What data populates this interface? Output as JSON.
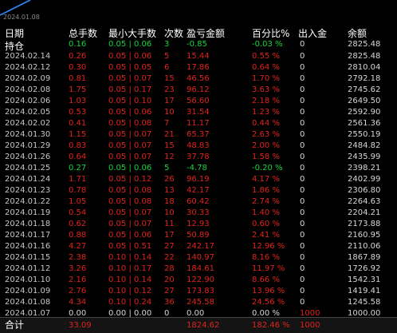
{
  "chart": {
    "date_label": "2024.01.08",
    "line_color": "#2a8cff"
  },
  "headers": {
    "date": "日期",
    "total_lots": "总手数",
    "min_max_lots": "最小大手数",
    "count": "次数",
    "profit": "盈亏金额",
    "percent": "百分比%",
    "deposit_withdraw": "出入金",
    "balance": "余额"
  },
  "holding": {
    "label": "持仓",
    "total_lots": "0.16",
    "min_max_lots": "0.05 | 0.06",
    "count": "3",
    "profit": "-0.85",
    "percent": "-0.03 %",
    "deposit_withdraw": "0",
    "balance": "2825.48"
  },
  "rows": [
    {
      "date": "2024.02.14",
      "lots": "0.26",
      "minmax": "0.05 | 0.06",
      "count": "5",
      "profit": "15.44",
      "pct": "0.55 %",
      "dw": "0",
      "bal": "2825.48",
      "color": "red"
    },
    {
      "date": "2024.02.12",
      "lots": "0.30",
      "minmax": "0.05 | 0.05",
      "count": "6",
      "profit": "17.86",
      "pct": "0.64 %",
      "dw": "0",
      "bal": "2810.04",
      "color": "red"
    },
    {
      "date": "2024.02.09",
      "lots": "0.81",
      "minmax": "0.05 | 0.07",
      "count": "15",
      "profit": "46.56",
      "pct": "1.70 %",
      "dw": "0",
      "bal": "2792.18",
      "color": "red"
    },
    {
      "date": "2024.02.08",
      "lots": "1.75",
      "minmax": "0.05 | 0.17",
      "count": "23",
      "profit": "96.12",
      "pct": "3.63 %",
      "dw": "0",
      "bal": "2745.62",
      "color": "red"
    },
    {
      "date": "2024.02.06",
      "lots": "1.03",
      "minmax": "0.05 | 0.10",
      "count": "17",
      "profit": "56.60",
      "pct": "2.18 %",
      "dw": "0",
      "bal": "2649.50",
      "color": "red"
    },
    {
      "date": "2024.02.05",
      "lots": "0.53",
      "minmax": "0.05 | 0.06",
      "count": "10",
      "profit": "31.54",
      "pct": "1.23 %",
      "dw": "0",
      "bal": "2592.90",
      "color": "red"
    },
    {
      "date": "2024.02.02",
      "lots": "0.41",
      "minmax": "0.05 | 0.08",
      "count": "7",
      "profit": "11.17",
      "pct": "0.44 %",
      "dw": "0",
      "bal": "2561.36",
      "color": "red"
    },
    {
      "date": "2024.01.30",
      "lots": "1.15",
      "minmax": "0.05 | 0.07",
      "count": "21",
      "profit": "65.37",
      "pct": "2.63 %",
      "dw": "0",
      "bal": "2550.19",
      "color": "red"
    },
    {
      "date": "2024.01.29",
      "lots": "0.83",
      "minmax": "0.05 | 0.07",
      "count": "15",
      "profit": "48.83",
      "pct": "2.00 %",
      "dw": "0",
      "bal": "2484.82",
      "color": "red"
    },
    {
      "date": "2024.01.26",
      "lots": "0.64",
      "minmax": "0.05 | 0.07",
      "count": "12",
      "profit": "37.78",
      "pct": "1.58 %",
      "dw": "0",
      "bal": "2435.99",
      "color": "red"
    },
    {
      "date": "2024.01.25",
      "lots": "0.27",
      "minmax": "0.05 | 0.06",
      "count": "5",
      "profit": "-4.78",
      "pct": "-0.20 %",
      "dw": "0",
      "bal": "2398.21",
      "color": "green"
    },
    {
      "date": "2024.01.24",
      "lots": "1.71",
      "minmax": "0.05 | 0.12",
      "count": "26",
      "profit": "96.19",
      "pct": "4.17 %",
      "dw": "0",
      "bal": "2402.99",
      "color": "red"
    },
    {
      "date": "2024.01.23",
      "lots": "0.78",
      "minmax": "0.05 | 0.08",
      "count": "13",
      "profit": "42.17",
      "pct": "1.86 %",
      "dw": "0",
      "bal": "2306.80",
      "color": "red"
    },
    {
      "date": "2024.01.22",
      "lots": "1.05",
      "minmax": "0.05 | 0.08",
      "count": "18",
      "profit": "60.42",
      "pct": "2.74 %",
      "dw": "0",
      "bal": "2264.63",
      "color": "red"
    },
    {
      "date": "2024.01.19",
      "lots": "0.54",
      "minmax": "0.05 | 0.07",
      "count": "10",
      "profit": "30.33",
      "pct": "1.40 %",
      "dw": "0",
      "bal": "2204.21",
      "color": "red"
    },
    {
      "date": "2024.01.18",
      "lots": "0.62",
      "minmax": "0.05 | 0.07",
      "count": "11",
      "profit": "12.93",
      "pct": "0.60 %",
      "dw": "0",
      "bal": "2173.88",
      "color": "red"
    },
    {
      "date": "2024.01.17",
      "lots": "0.88",
      "minmax": "0.05 | 0.06",
      "count": "17",
      "profit": "50.89",
      "pct": "2.41 %",
      "dw": "0",
      "bal": "2160.95",
      "color": "red"
    },
    {
      "date": "2024.01.16",
      "lots": "4.27",
      "minmax": "0.05 | 0.51",
      "count": "27",
      "profit": "242.17",
      "pct": "12.96 %",
      "dw": "0",
      "bal": "2110.06",
      "color": "red"
    },
    {
      "date": "2024.01.15",
      "lots": "2.38",
      "minmax": "0.10 | 0.14",
      "count": "22",
      "profit": "140.97",
      "pct": "8.16 %",
      "dw": "0",
      "bal": "1867.89",
      "color": "red"
    },
    {
      "date": "2024.01.12",
      "lots": "3.26",
      "minmax": "0.10 | 0.17",
      "count": "28",
      "profit": "184.61",
      "pct": "11.97 %",
      "dw": "0",
      "bal": "1726.92",
      "color": "red"
    },
    {
      "date": "2024.01.10",
      "lots": "2.16",
      "minmax": "0.10 | 0.14",
      "count": "20",
      "profit": "122.90",
      "pct": "8.66 %",
      "dw": "0",
      "bal": "1542.31",
      "color": "red"
    },
    {
      "date": "2024.01.09",
      "lots": "2.76",
      "minmax": "0.10 | 0.12",
      "count": "27",
      "profit": "173.83",
      "pct": "13.96 %",
      "dw": "0",
      "bal": "1419.41",
      "color": "red"
    },
    {
      "date": "2024.01.08",
      "lots": "4.34",
      "minmax": "0.10 | 0.24",
      "count": "36",
      "profit": "245.58",
      "pct": "24.56 %",
      "dw": "0",
      "bal": "1245.58",
      "color": "red"
    },
    {
      "date": "2024.01.07",
      "lots": "0.00",
      "minmax": "0.00 | 0.00",
      "count": "0",
      "profit": "0.00",
      "pct": "0.00 %",
      "dw": "1000",
      "bal": "1000.00",
      "color": "white"
    }
  ],
  "total": {
    "label": "合计",
    "lots": "33.09",
    "profit": "1824.62",
    "pct": "182.46 %",
    "dw": "1000"
  }
}
